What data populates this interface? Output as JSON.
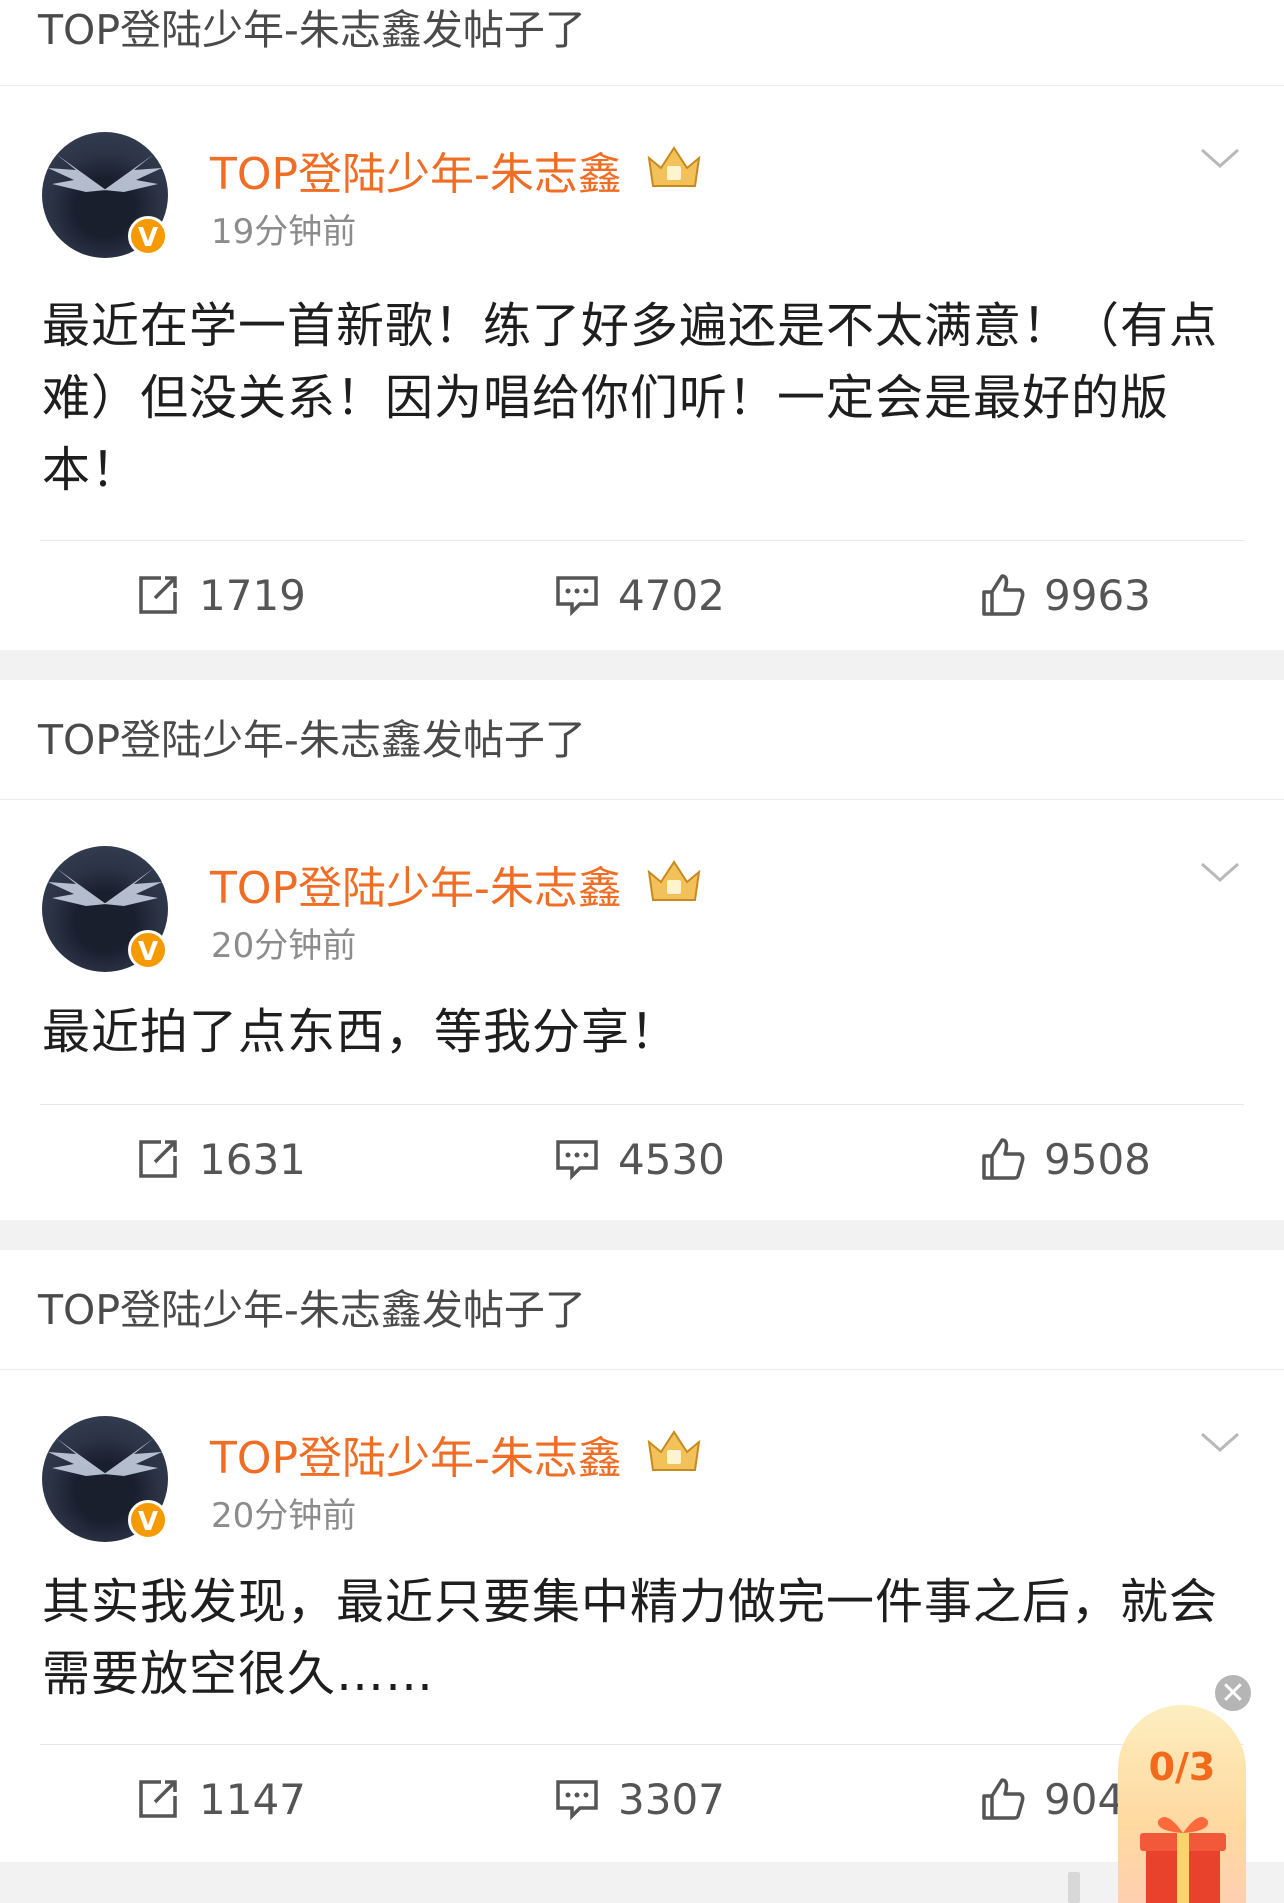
{
  "posts": [
    {
      "header": "TOP登陆少年-朱志鑫发帖子了",
      "username": "TOP登陆少年-朱志鑫",
      "verified_badge": "V",
      "time": "19分钟前",
      "content": "最近在学一首新歌！练了好多遍还是不太满意！（有点难）但没关系！因为唱给你们听！一定会是最好的版本！",
      "reposts": "1719",
      "comments": "4702",
      "likes": "9963"
    },
    {
      "header": "TOP登陆少年-朱志鑫发帖子了",
      "username": "TOP登陆少年-朱志鑫",
      "verified_badge": "V",
      "time": "20分钟前",
      "content": "最近拍了点东西，等我分享！",
      "reposts": "1631",
      "comments": "4530",
      "likes": "9508"
    },
    {
      "header": "TOP登陆少年-朱志鑫发帖子了",
      "username": "TOP登陆少年-朱志鑫",
      "verified_badge": "V",
      "time": "20分钟前",
      "content": "其实我发现，最近只要集中精力做完一件事之后，就会需要放空很久……",
      "reposts": "1147",
      "comments": "3307",
      "likes": "904"
    }
  ],
  "float_widget": {
    "count": "0/3",
    "close": "✕"
  },
  "colors": {
    "username": "#f06d25",
    "badge": "#f59a00",
    "background": "#f2f2f2"
  },
  "icons": [
    "repost-icon",
    "comment-icon",
    "like-icon",
    "chevron-down-icon",
    "crown-icon",
    "gift-icon",
    "close-icon"
  ]
}
